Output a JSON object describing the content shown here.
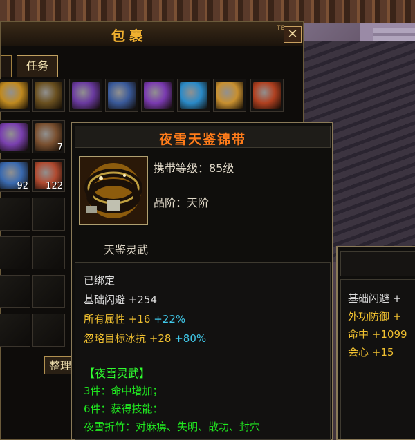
{
  "bag": {
    "title": "包裹",
    "close_label": "✕",
    "pin_label": "TE",
    "tab_task": "任务",
    "sort_button": "整理",
    "slots_row1": [
      {
        "name": "gold-charm-icon",
        "color": "#c08a20"
      },
      {
        "name": "jade-ring-icon",
        "color": "#6a5020"
      },
      {
        "name": "purple-blade-icon",
        "color": "#6a3aa0"
      },
      {
        "name": "ice-spear-icon",
        "color": "#3a5a9a"
      },
      {
        "name": "violet-blade-icon",
        "color": "#7a3ab0"
      },
      {
        "name": "frost-crystal-icon",
        "color": "#2a8ac8"
      },
      {
        "name": "compass-icon",
        "color": "#c89030"
      },
      {
        "name": "scroll-book-icon",
        "color": "#b04020"
      }
    ],
    "slots_row2": [
      {
        "name": "purple-cloth-icon",
        "color": "#7a40b0",
        "qty": ""
      },
      {
        "name": "coffin-box-icon",
        "color": "#7a5030",
        "qty": "7"
      }
    ],
    "slots_row3": [
      {
        "name": "blue-gift-icon",
        "color": "#3a6ab0",
        "qty": "92"
      },
      {
        "name": "red-ore-icon",
        "color": "#b04a30",
        "qty": "122"
      }
    ]
  },
  "tooltip": {
    "title": "夜雪天鉴锦带",
    "level": "携带等级：85级",
    "grade": "品阶：天阶",
    "set_name": "天鉴灵武",
    "bound": "已绑定",
    "stats": [
      {
        "label": "基础闪避",
        "value": "+254",
        "extra": ""
      },
      {
        "label": "所有属性",
        "value": "+16",
        "extra": "+22%"
      },
      {
        "label": "忽略目标冰抗",
        "value": "+28",
        "extra": "+80%"
      }
    ],
    "set_header": "【夜雪灵武】",
    "set_bonus": [
      "3件：命中增加；",
      "6件：获得技能："
    ],
    "skill_line": "夜雪折竹：对麻痹、失明、散功、封穴"
  },
  "compare": {
    "stats": [
      {
        "label": "基础闪避",
        "value": "+"
      },
      {
        "label": "外功防御",
        "value": "+"
      },
      {
        "label": "命中",
        "value": "+1099"
      },
      {
        "label": "会心",
        "value": "+15"
      }
    ]
  }
}
